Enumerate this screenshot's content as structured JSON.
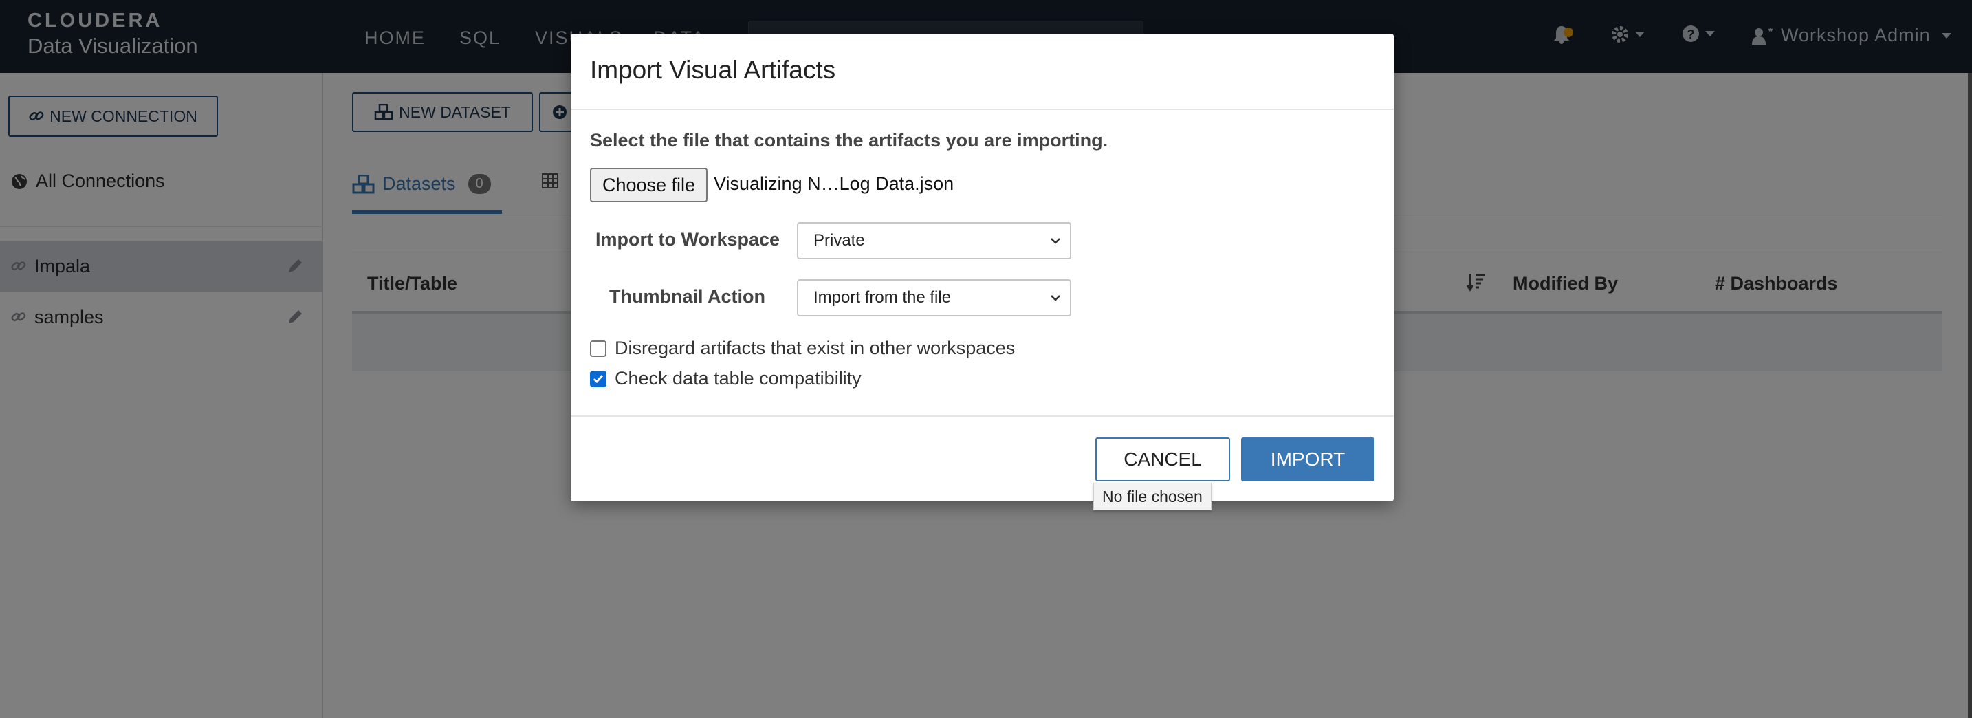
{
  "brand": {
    "line1": "CLOUDERA",
    "line2": "Data Visualization"
  },
  "nav": {
    "links": [
      "HOME",
      "SQL",
      "VISUALS",
      "DATA"
    ],
    "user": "Workshop Admin",
    "notification_color": "#f0a30a"
  },
  "sidebar": {
    "new_connection": "NEW CONNECTION",
    "all_connections": "All Connections",
    "items": [
      {
        "label": "Impala",
        "active": true
      },
      {
        "label": "samples",
        "active": false
      }
    ]
  },
  "main": {
    "new_dataset": "NEW DATASET",
    "tabs": [
      {
        "label": "Datasets",
        "count": "0"
      }
    ],
    "table_headers": [
      "Title/Table",
      "Modified By",
      "# Dashboards"
    ]
  },
  "modal": {
    "title": "Import Visual Artifacts",
    "lead": "Select the file that contains the artifacts you are importing.",
    "choose_file": "Choose file",
    "file_name": "Visualizing N…Log Data.json",
    "workspace_label": "Import to Workspace",
    "workspace_value": "Private",
    "thumbnail_label": "Thumbnail Action",
    "thumbnail_value": "Import from the file",
    "checks": [
      {
        "label": "Disregard artifacts that exist in other workspaces",
        "checked": false
      },
      {
        "label": "Check data table compatibility",
        "checked": true
      }
    ],
    "cancel": "CANCEL",
    "import": "IMPORT",
    "tooltip": "No file chosen"
  },
  "colors": {
    "navbar": "#18232f",
    "accent": "#3a78b5",
    "checkbox": "#0b69d4"
  }
}
